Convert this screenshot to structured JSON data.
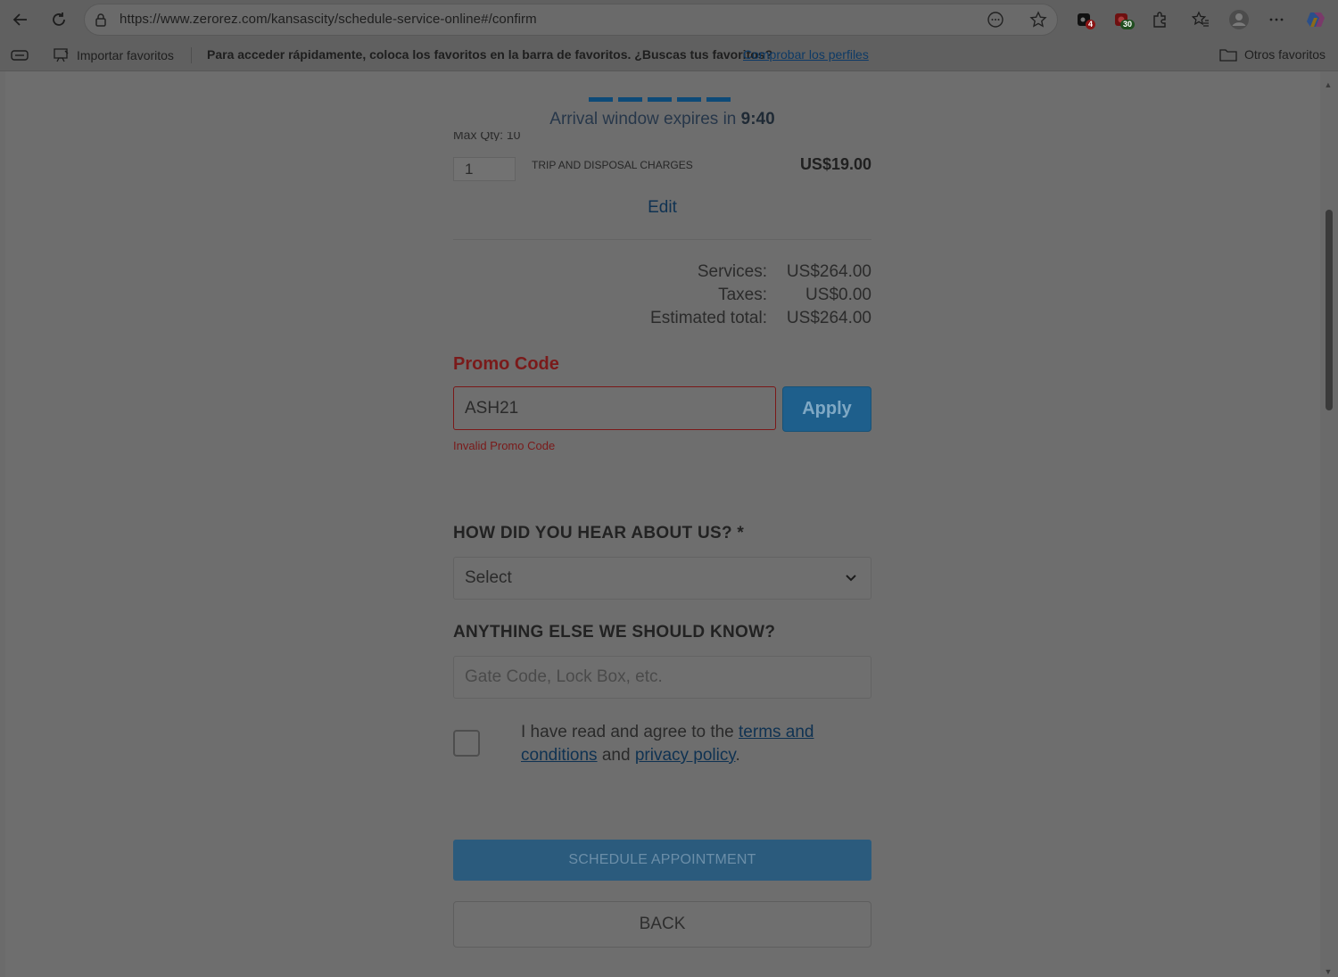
{
  "browser": {
    "url": "https://www.zerorez.com/kansascity/schedule-service-online#/confirm",
    "extension_badges": [
      "4",
      "30"
    ],
    "favorites_bar": {
      "import_label": "Importar favoritos",
      "message": "Para acceder rápidamente, coloca los favoritos en la barra de favoritos. ¿Buscas tus favoritos?",
      "link_label": "Comprobar los perfiles",
      "other_favorites_label": "Otros favoritos"
    }
  },
  "timer": {
    "prefix": "Arrival window expires in",
    "value": "9:40"
  },
  "cart": {
    "partial_text": "Max Qty: 10",
    "item": {
      "quantity": "1",
      "name": "TRIP AND DISPOSAL CHARGES",
      "price": "US$19.00"
    },
    "edit_label": "Edit"
  },
  "summary": {
    "services_label": "Services:",
    "services_value": "US$264.00",
    "taxes_label": "Taxes:",
    "taxes_value": "US$0.00",
    "total_label": "Estimated total:",
    "total_value": "US$264.00"
  },
  "promo": {
    "title": "Promo Code",
    "value": "ASH21",
    "apply_label": "Apply",
    "error": "Invalid Promo Code"
  },
  "hear_about": {
    "label": "HOW DID YOU HEAR ABOUT US? *",
    "selected": "Select"
  },
  "notes": {
    "label": "ANYTHING ELSE WE SHOULD KNOW?",
    "placeholder": "Gate Code, Lock Box, etc."
  },
  "agreement": {
    "prefix": "I have read and agree to the",
    "terms_link": "terms and conditions",
    "middle": "and",
    "privacy_link": "privacy policy",
    "suffix": "."
  },
  "actions": {
    "schedule_label": "SCHEDULE APPOINTMENT",
    "back_label": "BACK"
  },
  "colors": {
    "accent": "#1e5f8c",
    "error": "#7a1a1a",
    "overlay_background": "#6e6e6e"
  }
}
